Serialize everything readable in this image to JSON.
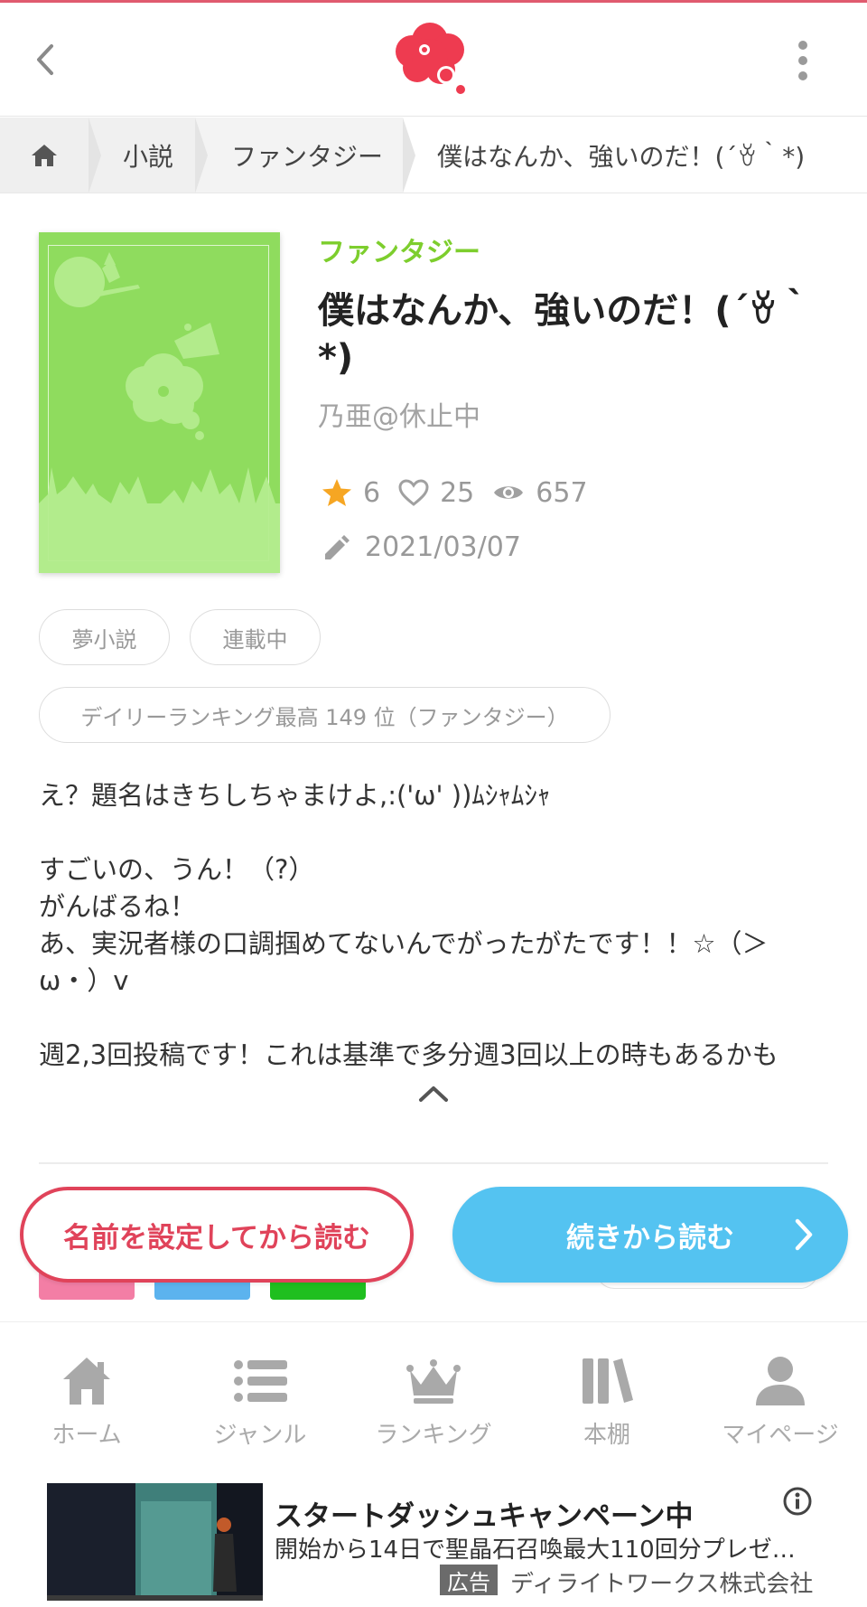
{
  "header": {
    "back_icon": "chevron-left-icon",
    "logo": "cloud-logo",
    "more_icon": "vertical-dots-icon",
    "accent_color": "#e0435a"
  },
  "breadcrumb": {
    "home_icon": "home-icon",
    "items": [
      "小説",
      "ファンタジー",
      "僕はなんか、強いのだ！(´ꈊ｀*)"
    ]
  },
  "book": {
    "genre": "ファンタジー",
    "title": "僕はなんか、強いのだ！(´ꈊ｀*)",
    "author": "乃亜@休止中",
    "stars": "6",
    "likes": "25",
    "views": "657",
    "updated": "2021/03/07",
    "genre_color": "#7dce2d"
  },
  "tags": [
    "夢小説",
    "連載中",
    "デイリーランキング最高 149 位（ファンタジー）"
  ],
  "description": [
    "え？題名はきちしちゃまけよ,:('ω' ))ﾑｼｬﾑｼｬ",
    "",
    "すごいの、うん！（?）",
    "がんばるね！",
    "あ、実況者様の口調掴めてないんでがったがたです！！☆（＞ω・）v",
    "",
    "週2,3回投稿です！これは基準で多分週3回以上の時もあるかも"
  ],
  "actions": {
    "name_button": "名前を設定してから読む",
    "continue_button": "続きから読む"
  },
  "bottom_nav": [
    {
      "label": "ホーム",
      "icon": "home-icon"
    },
    {
      "label": "ジャンル",
      "icon": "list-icon"
    },
    {
      "label": "ランキング",
      "icon": "crown-icon"
    },
    {
      "label": "本棚",
      "icon": "bookshelf-icon"
    },
    {
      "label": "マイページ",
      "icon": "user-icon"
    }
  ],
  "ad": {
    "title": "スタートダッシュキャンペーン中",
    "subtitle": "開始から14日で聖晶石召喚最大110回分プレゼン…",
    "label": "広告",
    "company": "ディライトワークス株式会社"
  }
}
